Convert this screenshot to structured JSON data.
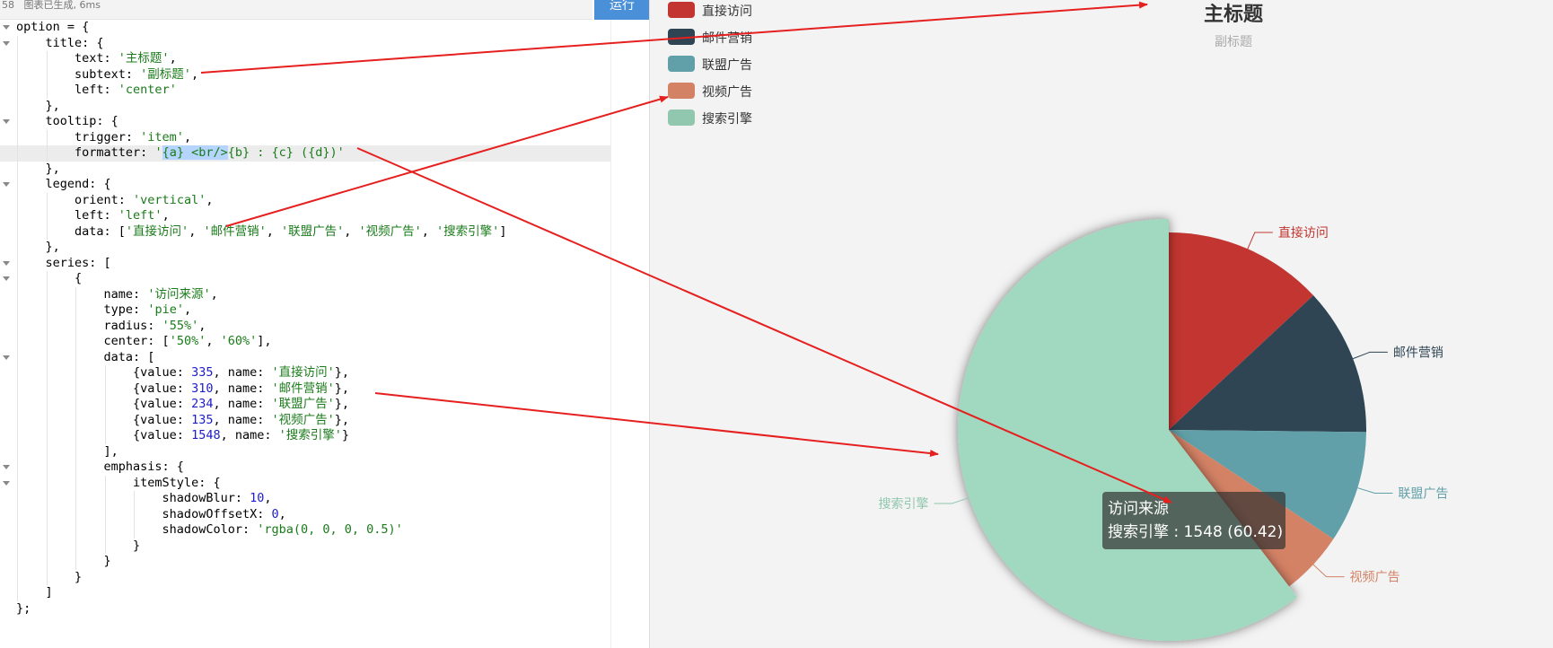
{
  "editor": {
    "status": "58   图表已生成, 6ms",
    "run_label": "运行",
    "lines": [
      {
        "fold": true,
        "indent": 0,
        "parts": [
          [
            "t",
            "option = {"
          ]
        ]
      },
      {
        "fold": true,
        "indent": 1,
        "parts": [
          [
            "t",
            "    title: {"
          ]
        ]
      },
      {
        "indent": 2,
        "parts": [
          [
            "t",
            "        text: "
          ],
          [
            "s",
            "'主标题'"
          ],
          [
            "t",
            ","
          ]
        ]
      },
      {
        "indent": 2,
        "parts": [
          [
            "t",
            "        subtext: "
          ],
          [
            "s",
            "'副标题'"
          ],
          [
            "t",
            ","
          ]
        ]
      },
      {
        "indent": 2,
        "parts": [
          [
            "t",
            "        left: "
          ],
          [
            "s",
            "'center'"
          ]
        ]
      },
      {
        "indent": 1,
        "parts": [
          [
            "t",
            "    },"
          ]
        ]
      },
      {
        "fold": true,
        "indent": 1,
        "parts": [
          [
            "t",
            "    tooltip: {"
          ]
        ]
      },
      {
        "indent": 2,
        "parts": [
          [
            "t",
            "        trigger: "
          ],
          [
            "s",
            "'item'"
          ],
          [
            "t",
            ","
          ]
        ]
      },
      {
        "indent": 2,
        "hl": true,
        "parts": [
          [
            "t",
            "        formatter: "
          ],
          [
            "s",
            "'"
          ],
          [
            "x",
            "{a} <br/>"
          ],
          [
            "s",
            "{b} : {c} ({d})'"
          ]
        ]
      },
      {
        "indent": 1,
        "parts": [
          [
            "t",
            "    },"
          ]
        ]
      },
      {
        "fold": true,
        "indent": 1,
        "parts": [
          [
            "t",
            "    legend: {"
          ]
        ]
      },
      {
        "indent": 2,
        "parts": [
          [
            "t",
            "        orient: "
          ],
          [
            "s",
            "'vertical'"
          ],
          [
            "t",
            ","
          ]
        ]
      },
      {
        "indent": 2,
        "parts": [
          [
            "t",
            "        left: "
          ],
          [
            "s",
            "'left'"
          ],
          [
            "t",
            ","
          ]
        ]
      },
      {
        "indent": 2,
        "parts": [
          [
            "t",
            "        data: ["
          ],
          [
            "s",
            "'直接访问'"
          ],
          [
            "t",
            ", "
          ],
          [
            "s",
            "'邮件营销'"
          ],
          [
            "t",
            ", "
          ],
          [
            "s",
            "'联盟广告'"
          ],
          [
            "t",
            ", "
          ],
          [
            "s",
            "'视频广告'"
          ],
          [
            "t",
            ", "
          ],
          [
            "s",
            "'搜索引擎'"
          ],
          [
            "t",
            "]"
          ]
        ]
      },
      {
        "indent": 1,
        "parts": [
          [
            "t",
            "    },"
          ]
        ]
      },
      {
        "fold": true,
        "indent": 1,
        "parts": [
          [
            "t",
            "    series: ["
          ]
        ]
      },
      {
        "fold": true,
        "indent": 2,
        "parts": [
          [
            "t",
            "        {"
          ]
        ]
      },
      {
        "indent": 3,
        "parts": [
          [
            "t",
            "            name: "
          ],
          [
            "s",
            "'访问来源'"
          ],
          [
            "t",
            ","
          ]
        ]
      },
      {
        "indent": 3,
        "parts": [
          [
            "t",
            "            type: "
          ],
          [
            "s",
            "'pie'"
          ],
          [
            "t",
            ","
          ]
        ]
      },
      {
        "indent": 3,
        "parts": [
          [
            "t",
            "            radius: "
          ],
          [
            "s",
            "'55%'"
          ],
          [
            "t",
            ","
          ]
        ]
      },
      {
        "indent": 3,
        "parts": [
          [
            "t",
            "            center: ["
          ],
          [
            "s",
            "'50%'"
          ],
          [
            "t",
            ", "
          ],
          [
            "s",
            "'60%'"
          ],
          [
            "t",
            "],"
          ]
        ]
      },
      {
        "fold": true,
        "indent": 3,
        "parts": [
          [
            "t",
            "            data: ["
          ]
        ]
      },
      {
        "indent": 4,
        "parts": [
          [
            "t",
            "                {value: "
          ],
          [
            "n",
            "335"
          ],
          [
            "t",
            ", name: "
          ],
          [
            "s",
            "'直接访问'"
          ],
          [
            "t",
            "},"
          ]
        ]
      },
      {
        "indent": 4,
        "parts": [
          [
            "t",
            "                {value: "
          ],
          [
            "n",
            "310"
          ],
          [
            "t",
            ", name: "
          ],
          [
            "s",
            "'邮件营销'"
          ],
          [
            "t",
            "},"
          ]
        ]
      },
      {
        "indent": 4,
        "parts": [
          [
            "t",
            "                {value: "
          ],
          [
            "n",
            "234"
          ],
          [
            "t",
            ", name: "
          ],
          [
            "s",
            "'联盟广告'"
          ],
          [
            "t",
            "},"
          ]
        ]
      },
      {
        "indent": 4,
        "parts": [
          [
            "t",
            "                {value: "
          ],
          [
            "n",
            "135"
          ],
          [
            "t",
            ", name: "
          ],
          [
            "s",
            "'视频广告'"
          ],
          [
            "t",
            "},"
          ]
        ]
      },
      {
        "indent": 4,
        "parts": [
          [
            "t",
            "                {value: "
          ],
          [
            "n",
            "1548"
          ],
          [
            "t",
            ", name: "
          ],
          [
            "s",
            "'搜索引擎'"
          ],
          [
            "t",
            "}"
          ]
        ]
      },
      {
        "indent": 3,
        "parts": [
          [
            "t",
            "            ],"
          ]
        ]
      },
      {
        "fold": true,
        "indent": 3,
        "parts": [
          [
            "t",
            "            emphasis: {"
          ]
        ]
      },
      {
        "fold": true,
        "indent": 4,
        "parts": [
          [
            "t",
            "                itemStyle: {"
          ]
        ]
      },
      {
        "indent": 5,
        "parts": [
          [
            "t",
            "                    shadowBlur: "
          ],
          [
            "n",
            "10"
          ],
          [
            "t",
            ","
          ]
        ]
      },
      {
        "indent": 5,
        "parts": [
          [
            "t",
            "                    shadowOffsetX: "
          ],
          [
            "n",
            "0"
          ],
          [
            "t",
            ","
          ]
        ]
      },
      {
        "indent": 5,
        "parts": [
          [
            "t",
            "                    shadowColor: "
          ],
          [
            "s",
            "'rgba(0, 0, 0, 0.5)'"
          ]
        ]
      },
      {
        "indent": 4,
        "parts": [
          [
            "t",
            "                }"
          ]
        ]
      },
      {
        "indent": 3,
        "parts": [
          [
            "t",
            "            }"
          ]
        ]
      },
      {
        "indent": 2,
        "parts": [
          [
            "t",
            "        }"
          ]
        ]
      },
      {
        "indent": 1,
        "parts": [
          [
            "t",
            "    ]"
          ]
        ]
      },
      {
        "indent": 0,
        "parts": [
          [
            "t",
            "};"
          ]
        ]
      }
    ]
  },
  "chart": {
    "title": "主标题",
    "subtitle": "副标题",
    "legend": [
      "直接访问",
      "邮件营销",
      "联盟广告",
      "视频广告",
      "搜索引擎"
    ],
    "tooltip": {
      "series": "访问来源",
      "detail": "搜索引擎 : 1548 (60.42)"
    }
  },
  "chart_data": {
    "type": "pie",
    "title": "主标题",
    "subtitle": "副标题",
    "series_name": "访问来源",
    "categories": [
      "直接访问",
      "邮件营销",
      "联盟广告",
      "视频广告",
      "搜索引擎"
    ],
    "values": [
      335,
      310,
      234,
      135,
      1548
    ],
    "colors": [
      "#c23531",
      "#2f4554",
      "#61a0a8",
      "#d48265",
      "#91c7ae"
    ],
    "emphasized": "搜索引擎",
    "legend_position": "top-left, vertical"
  }
}
